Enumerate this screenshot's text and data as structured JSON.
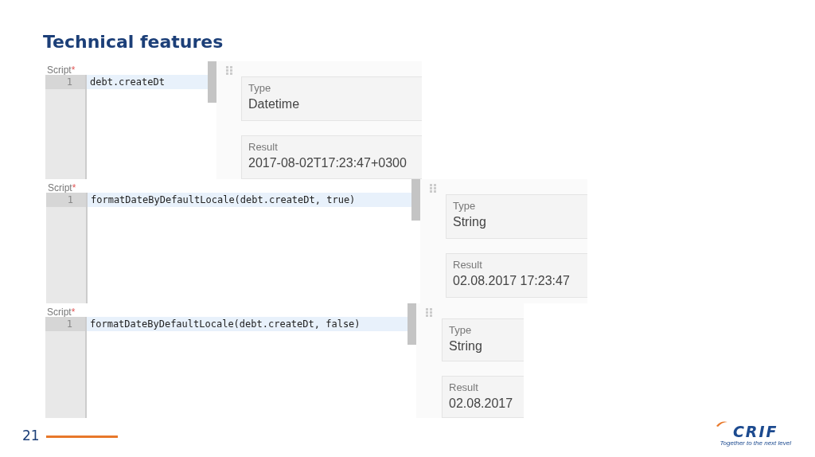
{
  "slide": {
    "title": "Technical features",
    "page_number": "21"
  },
  "panels": [
    {
      "script_label": "Script",
      "required_mark": "*",
      "line_number": "1",
      "code": "debt.createDt",
      "type_label": "Type",
      "type_value": "Datetime",
      "result_label": "Result",
      "result_value": "2017-08-02T17:23:47+0300"
    },
    {
      "script_label": "Script",
      "required_mark": "*",
      "line_number": "1",
      "code": "formatDateByDefaultLocale(debt.createDt, true)",
      "type_label": "Type",
      "type_value": "String",
      "result_label": "Result",
      "result_value": "02.08.2017 17:23:47"
    },
    {
      "script_label": "Script",
      "required_mark": "*",
      "line_number": "1",
      "code": "formatDateByDefaultLocale(debt.createDt, false)",
      "type_label": "Type",
      "type_value": "String",
      "result_label": "Result",
      "result_value": "02.08.2017"
    }
  ],
  "logo": {
    "name": "CRIF",
    "tagline": "Together to the next level"
  }
}
